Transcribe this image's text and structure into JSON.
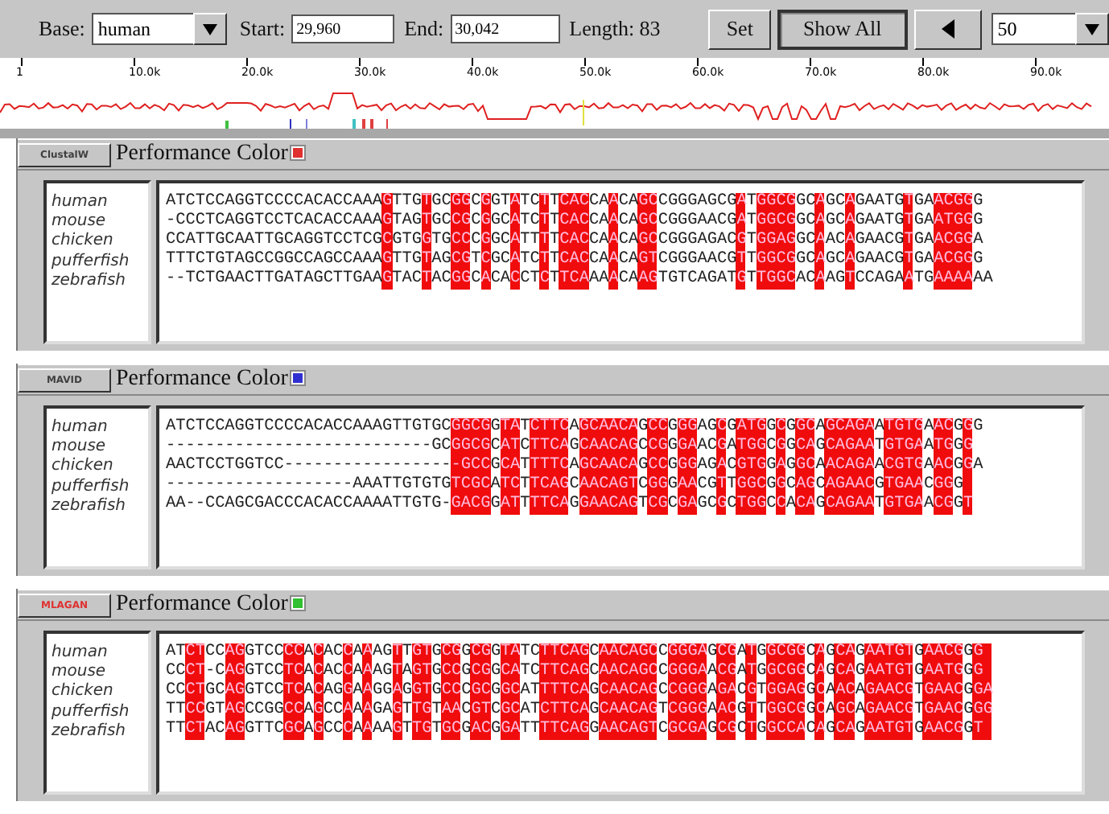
{
  "toolbar": {
    "base_label": "Base:",
    "base_value": "human",
    "start_label": "Start:",
    "start_value": "29,960",
    "end_label": "End:",
    "end_value": "30,042",
    "length": "Length: 83",
    "set_button": "Set",
    "show_all_button": "Show All",
    "show_all_pressed": true,
    "zoom_value": "50"
  },
  "ruler": {
    "ticks": [
      "1",
      "10.0k",
      "20.0k",
      "30.0k",
      "40.0k",
      "50.0k",
      "60.0k",
      "70.0k",
      "80.0k",
      "90.0k"
    ]
  },
  "panels": [
    {
      "method": "ClustalW",
      "label_highlighted": false,
      "title": "Performance Color",
      "color": "#e03030",
      "species": [
        "human",
        "mouse",
        "chicken",
        "pufferfish",
        "zebrafish"
      ],
      "sequences": [
        "ATCTCCAGGTCCCCACACCAAAGTTGTGCGGCGGTATCTTCACCAACAGCCGGGAGCGATGGCGGCAGCAGAATGTGAACGGG",
        "-CCCTCAGGTCCTCACACCAAAGTAGTGCCGCGGCATCTTCACCAACAGCCGGGAACGATGGCGGCAGCAGAATGTGAATGGG",
        "CCATTGCAATTGCAGGTCCTCGCGTGGTGCCCGGCATTTTCACCAACAGCCGGGAGACGTGGAGGCAACAGAACGTGAACGGA",
        "TTTCTGTAGCCGGCCAGCCAAAGTTGTAGCGTCGCATCTTCACCAACAGTCGGGAACGTTGGCGGCAGCAGAACGTGAACGGG",
        "--TCTGAACTTGATAGCTTGAAGTACTACGGCACACCTCTTCAAAACAAGTGTCAGATGTTGGCACAAGTCCAGAATGAAAAAA"
      ],
      "conserved": [
        false,
        false,
        false,
        false,
        false,
        false,
        false,
        false,
        false,
        false,
        false,
        false,
        false,
        false,
        false,
        false,
        false,
        false,
        false,
        false,
        false,
        false,
        true,
        false,
        false,
        false,
        true,
        false,
        false,
        true,
        true,
        false,
        true,
        false,
        false,
        true,
        false,
        false,
        true,
        false,
        true,
        true,
        true,
        false,
        false,
        true,
        false,
        false,
        true,
        true,
        false,
        false,
        false,
        false,
        false,
        false,
        false,
        false,
        true,
        false,
        true,
        true,
        true,
        true,
        false,
        false,
        true,
        false,
        false,
        true,
        false,
        false,
        false,
        false,
        false,
        true,
        false,
        false,
        true,
        true,
        true,
        true,
        false
      ]
    },
    {
      "method": "MAVID",
      "label_highlighted": false,
      "title": "Performance Color",
      "color": "#3030d0",
      "species": [
        "human",
        "mouse",
        "chicken",
        "pufferfish",
        "zebrafish"
      ],
      "sequences": [
        "ATCTCCAGGTCCCCACACCAAAGTTGTGCGGCGGTATCTTCAGCAACAGCCGGGAGCGATGGCGGCAGCAGAATGTGAACGGG",
        "---------------------------GCGGCGCATCTTCAGCAACAGCCGGGAACGATGGCGGCAGCAGAATGTGAATGGG",
        "AACTCCTGGTCC------------------GCCGCATTTTCAGCAACAGCCGGGAGACGTGGAGGCAACAGAACGTGAACGGA",
        "-------------------AAATTGTGTGTCGCATCTTCAGCAACAGTCGGGAACGTTGGCGGCAGCAGAACGTGAACGGG",
        "AA--CCAGCGACCCACACCAAAATTGTG-GACGGATTTTCAGGAACAGTCGCGAGCGCTGGCCACAGCAGAATGTGAACGGT"
      ],
      "conserved": [
        false,
        false,
        false,
        false,
        false,
        false,
        false,
        false,
        false,
        false,
        false,
        false,
        false,
        false,
        false,
        false,
        false,
        false,
        false,
        false,
        false,
        false,
        false,
        false,
        false,
        false,
        false,
        false,
        false,
        true,
        true,
        true,
        true,
        false,
        true,
        true,
        false,
        true,
        true,
        true,
        true,
        false,
        true,
        true,
        true,
        true,
        true,
        true,
        false,
        true,
        true,
        false,
        true,
        true,
        false,
        false,
        true,
        false,
        true,
        true,
        true,
        false,
        true,
        false,
        true,
        true,
        false,
        true,
        true,
        true,
        true,
        true,
        false,
        true,
        true,
        true,
        true,
        false,
        true,
        true,
        false,
        true
      ]
    },
    {
      "method": "MLAGAN",
      "label_highlighted": true,
      "title": "Performance Color",
      "color": "#30c030",
      "species": [
        "human",
        "mouse",
        "chicken",
        "pufferfish",
        "zebrafish"
      ],
      "sequences": [
        "ATCTCCAGGTCCCCACACCAAAGTTGTGCGGCGGTATCTTCAGCAACAGCCGGGAGCGATGGCGGCAGCAGAATGTGAACGGG",
        "CCCT-CAGGTCCTCACACCAAAGTAGTGCCGCGGCATCTTCAGCAACAGCCGGGAACGATGGCGGCAGCAGAATGTGAATGGG",
        "CCCTGCAGGTCCTCACAGGAAGGAGGTGCCCGCGGCATTTTCAGCAACAGCCGGGAGACGTGGAGGCAACAGAACGTGAACGGA",
        "TTCCGTAGCCGGCCAGCCAAAGAGTTGTAACGTCGCATCTTCAGCAACAGTCGGGAACGTTGGCGGCAGCAGAACGTGAACGGG",
        "TTCTACAGGTTCGCAGCCCAAAAGTTGTGCGACGGATTTTCAGGAACAGTCGCGAGCGCTGGCCACAGCAGAATGTGAACGGT"
      ],
      "conserved": [
        false,
        false,
        true,
        true,
        false,
        false,
        true,
        true,
        false,
        false,
        false,
        false,
        true,
        true,
        false,
        true,
        false,
        false,
        true,
        false,
        true,
        false,
        false,
        true,
        false,
        true,
        true,
        false,
        true,
        true,
        false,
        true,
        true,
        false,
        true,
        true,
        false,
        false,
        true,
        true,
        true,
        true,
        true,
        false,
        true,
        true,
        true,
        true,
        true,
        true,
        false,
        true,
        true,
        true,
        true,
        false,
        true,
        true,
        false,
        true,
        false,
        true,
        true,
        true,
        true,
        false,
        true,
        false,
        true,
        true,
        false,
        true,
        true,
        true,
        true,
        true,
        false,
        true,
        true,
        true,
        true,
        false,
        true,
        true
      ]
    }
  ]
}
